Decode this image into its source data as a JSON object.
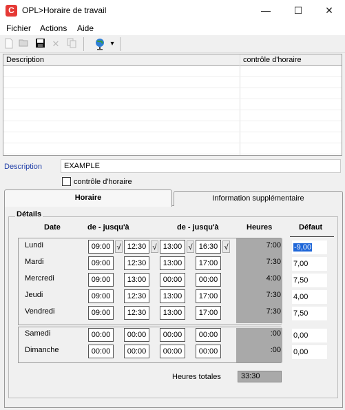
{
  "window": {
    "title": "OPL>Horaire de travail",
    "icon_letter": "C",
    "controls": {
      "minimize": "—",
      "maximize": "☐",
      "close": "✕"
    }
  },
  "menu": [
    "Fichier",
    "Actions",
    "Aide"
  ],
  "toolbar": {
    "icons": [
      "new-icon",
      "open-icon",
      "save-icon",
      "delete-icon",
      "copy-icon",
      "globe-icon"
    ],
    "dropdown": "▾"
  },
  "grid": {
    "columns": [
      "Description",
      "contrôle d'horaire"
    ],
    "rows": []
  },
  "form": {
    "description_label": "Description",
    "description_value": "EXAMPLE",
    "control_checkbox_label": "contrôle d'horaire",
    "control_checked": false
  },
  "tabs": [
    "Horaire",
    "Information supplémentaire"
  ],
  "details": {
    "section_label": "Détails",
    "headers": {
      "date": "Date",
      "range1": "de - jusqu'à",
      "range2": "de - jusqu'à",
      "hours": "Heures",
      "default": "Défaut"
    },
    "check_mark": "√",
    "days": [
      {
        "name": "Lundi",
        "t1": "09:00",
        "t2": "12:30",
        "t3": "13:00",
        "t4": "16:30",
        "hours": "7:00",
        "default": "-9,00"
      },
      {
        "name": "Mardi",
        "t1": "09:00",
        "t2": "12:30",
        "t3": "13:00",
        "t4": "17:00",
        "hours": "7:30",
        "default": "7,00"
      },
      {
        "name": "Mercredi",
        "t1": "09:00",
        "t2": "13:00",
        "t3": "00:00",
        "t4": "00:00",
        "hours": "4:00",
        "default": "7,50"
      },
      {
        "name": "Jeudi",
        "t1": "09:00",
        "t2": "12:30",
        "t3": "13:00",
        "t4": "17:00",
        "hours": "7:30",
        "default": "4,00"
      },
      {
        "name": "Vendredi",
        "t1": "09:00",
        "t2": "12:30",
        "t3": "13:00",
        "t4": "17:00",
        "hours": "7:30",
        "default": "7,50"
      },
      {
        "name": "Samedi",
        "t1": "00:00",
        "t2": "00:00",
        "t3": "00:00",
        "t4": "00:00",
        "hours": ":00",
        "default": "0,00"
      },
      {
        "name": "Dimanche",
        "t1": "00:00",
        "t2": "00:00",
        "t3": "00:00",
        "t4": "00:00",
        "hours": ":00",
        "default": "0,00"
      }
    ],
    "total_label": "Heures totales",
    "total_value": "33:30"
  }
}
